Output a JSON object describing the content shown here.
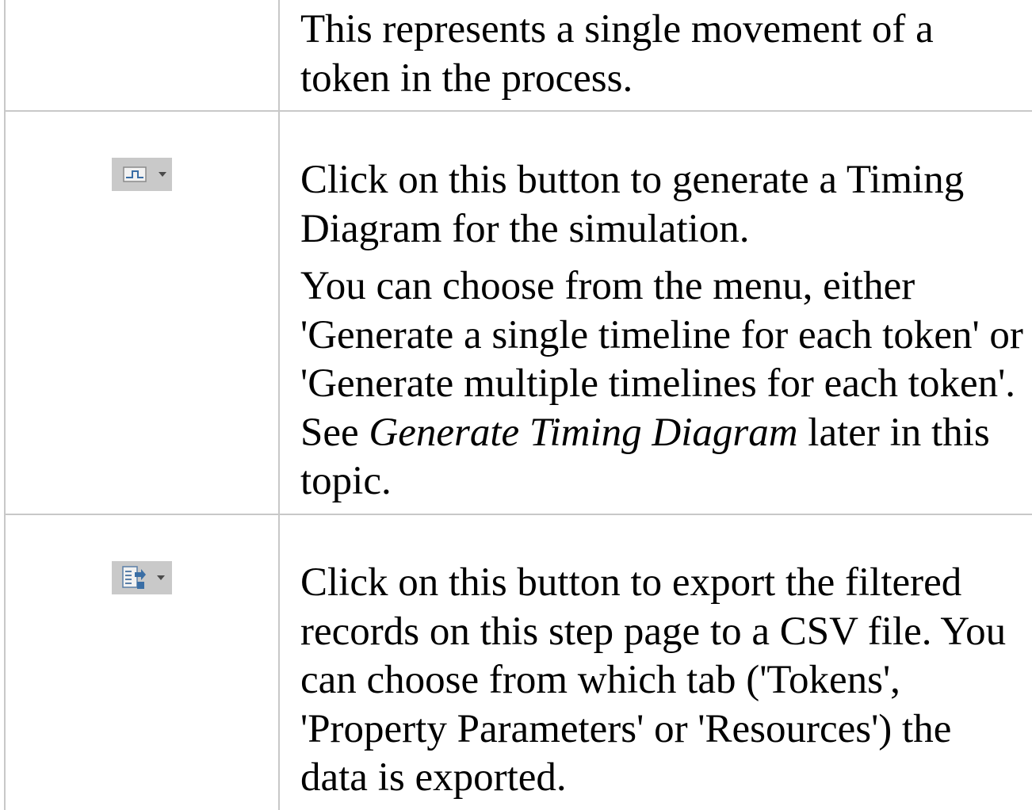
{
  "rows": [
    {
      "description": "This represents a single movement of a token in the process."
    },
    {
      "icon": "timing-diagram-icon",
      "paragraph_1": "Click on this button to generate a Timing Diagram for the simulation.",
      "paragraph_2_before": "You can choose from the menu, either 'Generate a single timeline for each token' or 'Generate multiple timelines for each token'. See ",
      "paragraph_2_link": "Generate Timing Diagram",
      "paragraph_2_after": " later in this topic."
    },
    {
      "icon": "export-csv-icon",
      "description": "Click on this button to export the filtered records on this step page to a CSV file. You can choose from which tab ('Tokens', 'Property Parameters' or 'Resources') the data is exported."
    }
  ]
}
